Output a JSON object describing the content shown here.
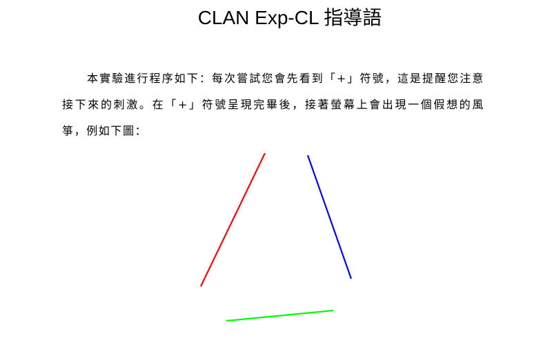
{
  "title": "CLAN Exp-CL 指導語",
  "instruction_text": "本實驗進行程序如下：每次嘗試您會先看到「+」符號，這是提醒您注意接下來的刺激。在「+」符號呈現完畢後，接著螢幕上會出現一個假想的風箏，例如下圖：",
  "kite_example": {
    "lines": [
      {
        "name": "left-red-line",
        "color": "#ff0000"
      },
      {
        "name": "right-blue-line",
        "color": "#0000ff"
      },
      {
        "name": "bottom-green-line",
        "color": "#00ff00"
      }
    ]
  }
}
